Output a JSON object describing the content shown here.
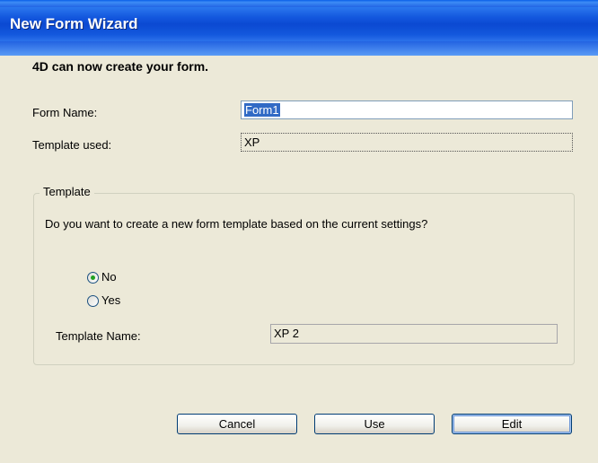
{
  "window": {
    "title": "New Form Wizard"
  },
  "main": {
    "heading": "4D can now create your form.",
    "form_name_label": "Form Name:",
    "form_name_value": "Form1",
    "template_used_label": "Template used:",
    "template_used_value": "XP"
  },
  "template_group": {
    "legend": "Template",
    "question": "Do you want to create a new form template based on the current settings?",
    "options": [
      {
        "label": "No",
        "selected": true
      },
      {
        "label": "Yes",
        "selected": false
      }
    ],
    "template_name_label": "Template Name:",
    "template_name_value": "XP 2"
  },
  "buttons": {
    "cancel": "Cancel",
    "use": "Use",
    "edit": "Edit"
  },
  "colors": {
    "title_bar": "#0b4fd8",
    "dialog_bg": "#ece9d8",
    "selection": "#316ac5",
    "radio_dot": "#21a121"
  }
}
